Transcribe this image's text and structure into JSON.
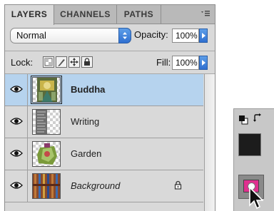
{
  "panel": {
    "tabs": [
      "LAYERS",
      "CHANNELS",
      "PATHS"
    ],
    "active_tab": "LAYERS",
    "blend_mode": "Normal",
    "opacity_label": "Opacity:",
    "opacity_value": "100%",
    "lock_label": "Lock:",
    "fill_label": "Fill:",
    "fill_value": "100%",
    "lock_icons": [
      "lock-transparent-pixels-icon",
      "lock-image-pixels-icon",
      "lock-position-icon",
      "lock-all-icon"
    ]
  },
  "layers": [
    {
      "name": "Buddha",
      "selected": true,
      "visible": true,
      "locked": false,
      "thumbnail": "buddha-image"
    },
    {
      "name": "Writing",
      "selected": false,
      "visible": true,
      "locked": false,
      "thumbnail": "writing-image"
    },
    {
      "name": "Garden",
      "selected": false,
      "visible": true,
      "locked": false,
      "thumbnail": "garden-image"
    },
    {
      "name": "Background",
      "selected": false,
      "visible": true,
      "locked": true,
      "thumbnail": "background-image"
    }
  ],
  "tools": {
    "foreground_color": "#1c1c1c",
    "quick_mask_color": "#e0308f",
    "icons": [
      "default-colors-icon",
      "swap-colors-icon",
      "quick-mask-icon",
      "arrow-cursor-icon"
    ]
  },
  "colors": {
    "panel_bg": "#d9d9d9",
    "selected_layer_bg": "#b6d3ee",
    "accent_blue": "#2f6fd0"
  }
}
